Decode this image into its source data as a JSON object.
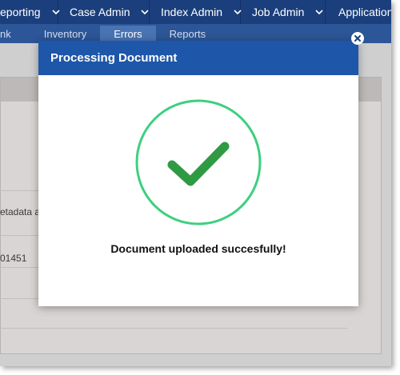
{
  "colors": {
    "nav_bg": "#1b3f7c",
    "subnav_bg": "#2c5697",
    "modal_header": "#1e56a9",
    "success_ring": "#3ecf7f",
    "success_check": "#2f9a43"
  },
  "topnav": {
    "items": [
      {
        "label": "eporting",
        "icon": "chevron-down-icon"
      },
      {
        "label": "Case Admin",
        "icon": "chevron-down-icon"
      },
      {
        "label": "Index Admin",
        "icon": "chevron-down-icon"
      },
      {
        "label": "Job Admin",
        "icon": "chevron-down-icon"
      },
      {
        "label": "Application",
        "icon": ""
      }
    ]
  },
  "subnav": {
    "tabs": [
      {
        "label": "nk",
        "active": false
      },
      {
        "label": "Inventory",
        "active": false
      },
      {
        "label": "Errors",
        "active": true
      },
      {
        "label": "Reports",
        "active": false
      }
    ]
  },
  "background": {
    "text1": "etadata a",
    "text2": "01451"
  },
  "modal": {
    "title": "Processing Document",
    "close_icon": "close-icon",
    "status_icon": "success-checkmark-icon",
    "message": "Document uploaded succesfully!"
  }
}
